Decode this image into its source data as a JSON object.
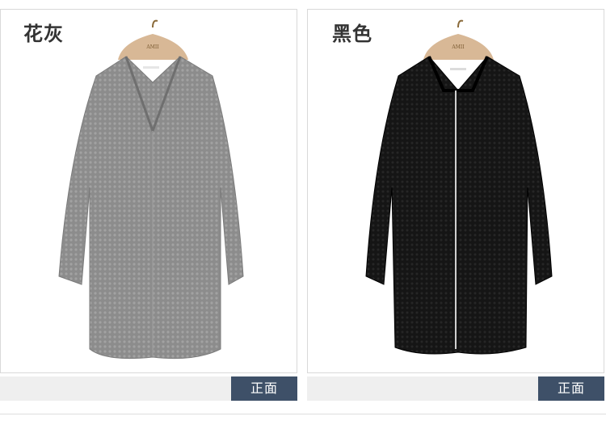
{
  "products": [
    {
      "color_name": "花灰",
      "view_label": "正面",
      "garment_color": "#8e8e8e",
      "hanger_text": "AMII"
    },
    {
      "color_name": "黑色",
      "view_label": "正面",
      "garment_color": "#141414",
      "hanger_text": "AMII"
    }
  ]
}
